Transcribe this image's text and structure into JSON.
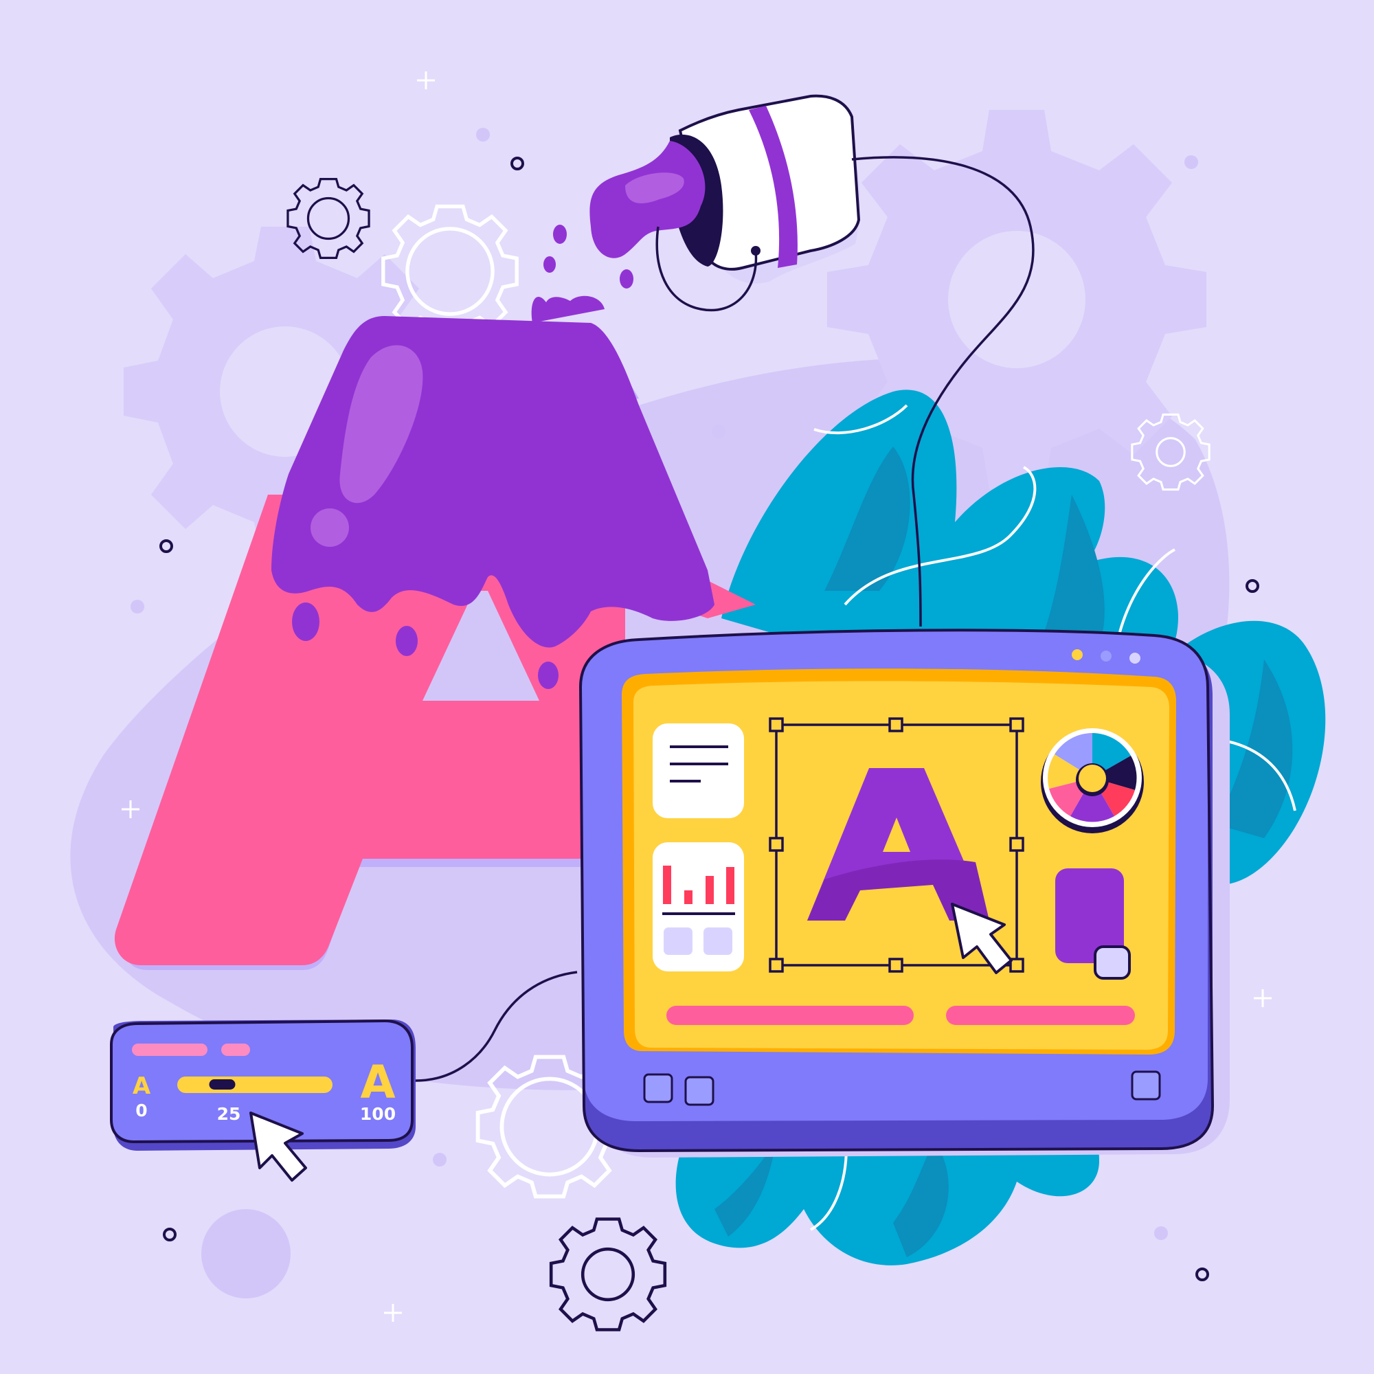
{
  "colors": {
    "background": "#e3dcfb",
    "blob": "#d2c6f9",
    "gear_ghost": "#d9cffa",
    "letter_pink": "#ff5e9c",
    "letter_purple": "#9133d3",
    "leaf_teal": "#00a8d4",
    "leaf_teal_dark": "#0b8fbc",
    "tablet_frame": "#7f7bfa",
    "tablet_frame_dark": "#5448c8",
    "screen_yellow": "#ffd240",
    "screen_orange": "#ffae00",
    "bar_pink": "#ff5e9c",
    "chart_red": "#ff3c5c",
    "outline": "#1e104a"
  },
  "slider_panel": {
    "small_letter": "A",
    "large_letter": "A",
    "min_label": "0",
    "value_label": "25",
    "max_label": "100",
    "value": 25,
    "min": 0,
    "max": 100
  },
  "screen": {
    "selected_letter": "A"
  },
  "icons": [
    "paint-bucket-icon",
    "gear-icon",
    "cursor-icon",
    "text-lines-icon",
    "bar-chart-icon",
    "color-wheel-icon",
    "color-swatch-icon"
  ]
}
